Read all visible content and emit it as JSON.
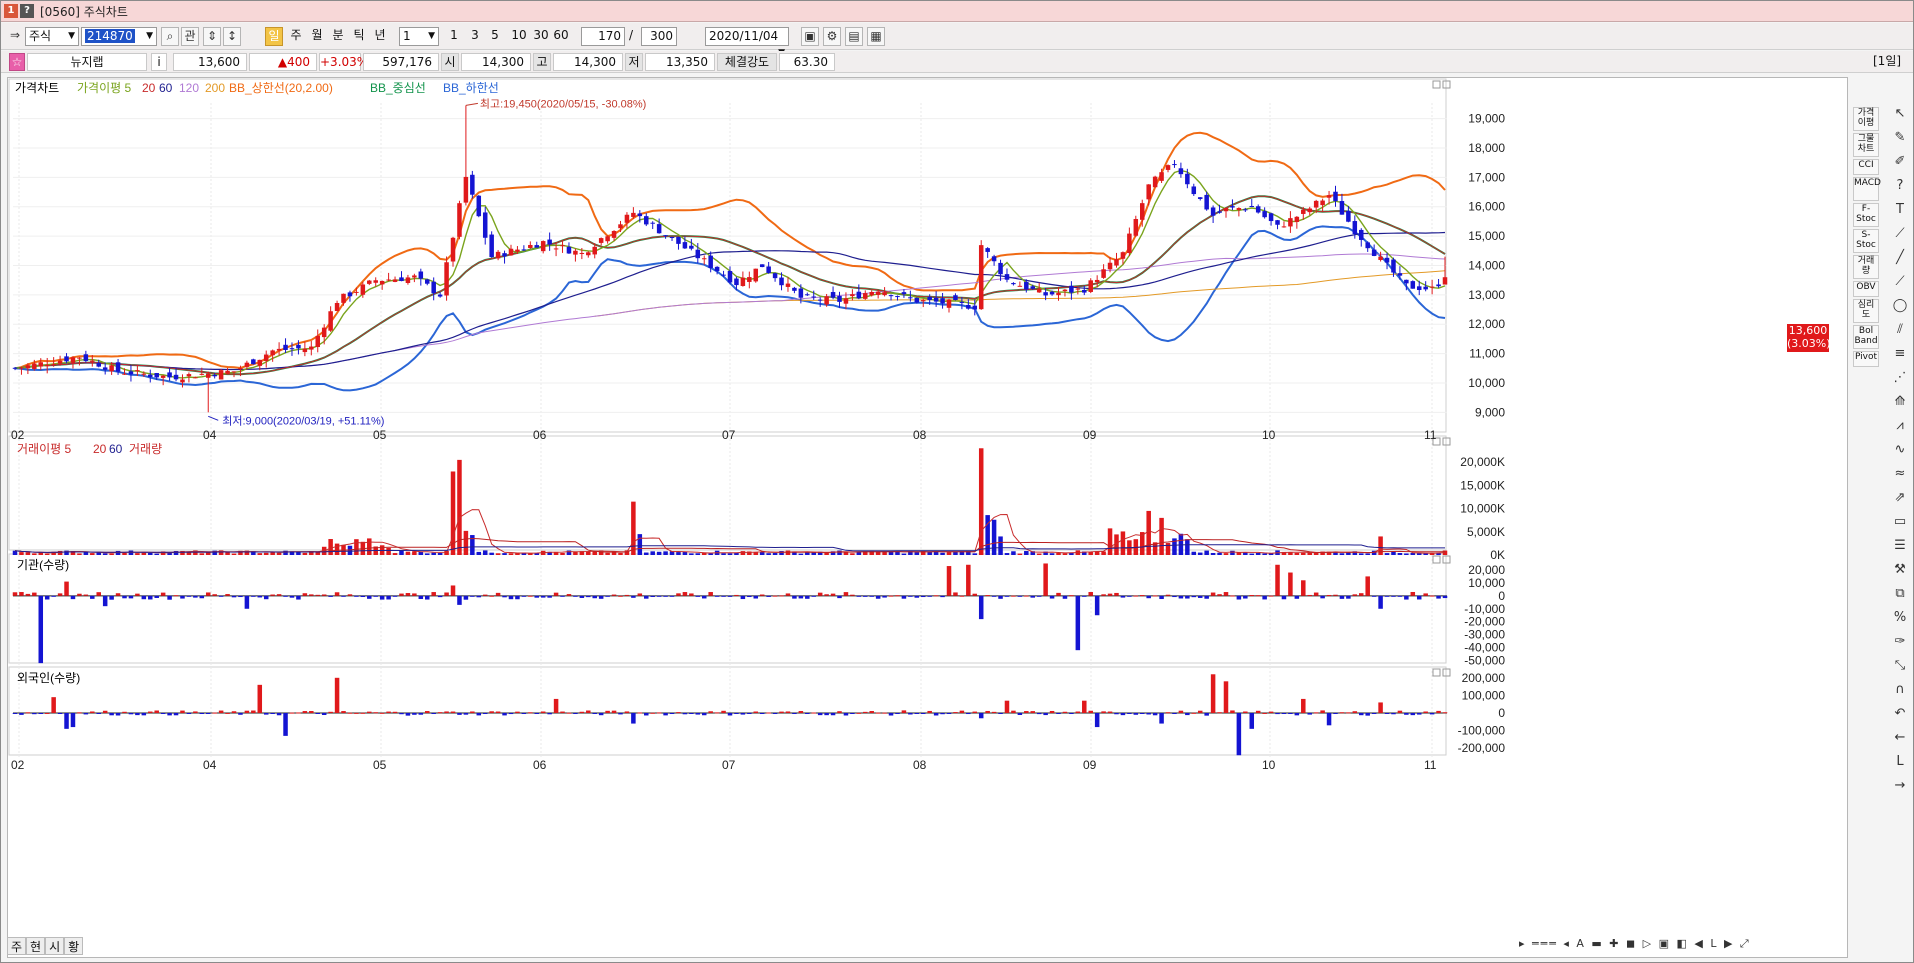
{
  "window": {
    "title": "[0560] 주식차트"
  },
  "toolbar": {
    "market_select": "주식",
    "code_value": "214870",
    "search_btn": "관",
    "period_buttons": [
      "주",
      "월",
      "분",
      "틱",
      "년"
    ],
    "day_btn": "일",
    "interval_select": "1",
    "interval_buttons": [
      "1",
      "3",
      "5",
      "10",
      "30",
      "60"
    ],
    "count_value": "170",
    "count_total": "300",
    "date_value": "2020/11/04"
  },
  "infobar": {
    "name": "뉴지랩",
    "info_icon": "i",
    "price": "13,600",
    "change": "▲400",
    "change_pct": "+3.03%",
    "volume": "597,176",
    "open_label": "시",
    "open": "14,300",
    "high_label": "고",
    "high": "14,300",
    "low_label": "저",
    "low": "13,350",
    "strength_label": "체결강도",
    "strength": "63.30",
    "period_badge": "[1일]"
  },
  "colors": {
    "up": "#e0191b",
    "down": "#1414d2",
    "ma5": "#7aa41d",
    "ma20": "#c82b2b",
    "ma60": "#1f1f8f",
    "ma120": "#b07ad4",
    "ma200": "#e39a27",
    "bb_upper": "#f06a14",
    "bb_mid": "#12934b",
    "bb_lower": "#2b66d6"
  },
  "chart_data": [
    {
      "type": "candlestick",
      "title": "가격차트",
      "legend": [
        "가격차트",
        "가격이평 5",
        "20",
        "60",
        "120",
        "200",
        "BB_상한선(20,2.00)",
        "BB_중심선",
        "BB_하한선"
      ],
      "x_month_labels": [
        "02",
        "04",
        "05",
        "06",
        "07",
        "08",
        "09",
        "10",
        "11"
      ],
      "y_ticks": [
        "19,000",
        "18,000",
        "17,000",
        "16,000",
        "15,000",
        "14,000",
        "13,000",
        "12,000",
        "11,000",
        "10,000",
        "9,000"
      ],
      "ylim": [
        8500,
        19600
      ],
      "annotations": [
        "최고:19,450(2020/05/15, -30.08%)",
        "최저:9,000(2020/03/19, +51.11%)"
      ],
      "current_price_label": "13,600",
      "current_pct_label": "(3.03%)"
    },
    {
      "type": "bar",
      "title": "거래량",
      "legend": [
        "거래이평 5",
        "20",
        "60",
        "거래량"
      ],
      "y_ticks": [
        "20,000K",
        "15,000K",
        "10,000K",
        "5,000K",
        "0K"
      ],
      "ylim": [
        0,
        25000
      ]
    },
    {
      "type": "bar",
      "title": "기관(수량)",
      "y_ticks": [
        "20,000",
        "10,000",
        "0",
        "-10,000",
        "-20,000",
        "-30,000",
        "-40,000",
        "-50,000"
      ],
      "ylim": [
        -55000,
        30000
      ]
    },
    {
      "type": "bar",
      "title": "외국인(수량)",
      "y_ticks": [
        "200,000",
        "100,000",
        "0",
        "-100,000",
        "-200,000"
      ],
      "ylim": [
        -250000,
        250000
      ]
    }
  ],
  "bottom": {
    "tabs": [
      "주",
      "현",
      "시",
      "황"
    ]
  },
  "rightbar": {
    "indicators": [
      "가격이평",
      "그물차트",
      "CCI",
      "MACD",
      "F-Stoc",
      "S-Stoc",
      "거래량",
      "OBV",
      "심리도",
      "Bol Band",
      "Pivot"
    ]
  }
}
